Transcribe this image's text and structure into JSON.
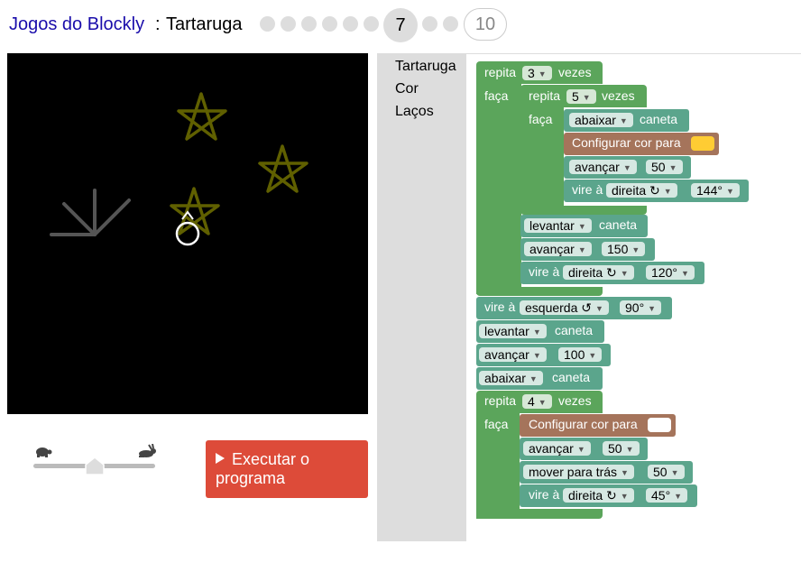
{
  "header": {
    "app_link": "Jogos do Blockly",
    "separator": ":",
    "app_name": "Tartaruga",
    "current_level": "7",
    "last_level": "10"
  },
  "toolbox": {
    "categories": [
      "Tartaruga",
      "Cor",
      "Laços"
    ]
  },
  "run_button": {
    "label_line1": "Executar o",
    "label_line2": "programa"
  },
  "colors": {
    "star": "#606000",
    "set_color_1": "#ffcc33",
    "set_color_2": "#ffffff",
    "loop_block": "#5ba55b",
    "turtle_block": "#5ba58c",
    "color_block": "#a5745b",
    "run_button": "#dd4b39"
  },
  "blocks": {
    "repeat": "repita",
    "times": "vezes",
    "do": "faça",
    "pen": "caneta",
    "pen_down": "abaixar",
    "pen_up": "levantar",
    "set_color": "Configurar cor para",
    "move_forward": "avançar",
    "move_back": "mover para trás",
    "turn": "vire à",
    "right": "direita ↻",
    "left": "esquerda ↺",
    "outer_count": "3",
    "inner_count": "5",
    "star_step": "50",
    "star_angle": "144°",
    "gap_step": "150",
    "gap_angle": "120°",
    "left_angle": "90°",
    "advance_100": "100",
    "rays_count": "4",
    "ray_step": "50",
    "ray_back": "50",
    "ray_angle": "45°"
  }
}
